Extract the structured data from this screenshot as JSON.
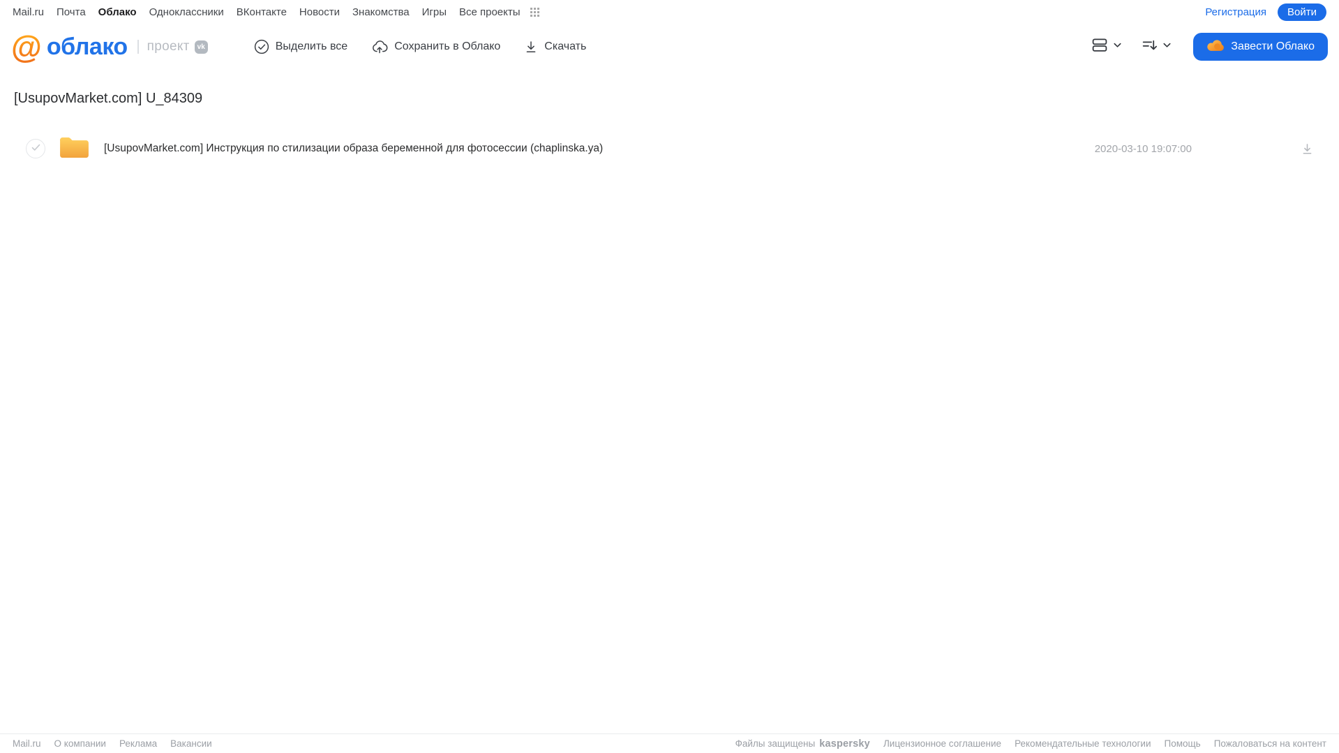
{
  "topnav": {
    "links": [
      "Mail.ru",
      "Почта",
      "Облако",
      "Одноклассники",
      "ВКонтакте",
      "Новости",
      "Знакомства",
      "Игры",
      "Все проекты"
    ],
    "active_link": "Облако",
    "registration_label": "Регистрация",
    "login_label": "Войти"
  },
  "header": {
    "logo": {
      "at_symbol": "@",
      "text": "облако",
      "project_label": "проект",
      "vk_badge": "vk"
    },
    "toolbar": {
      "select_all": "Выделить все",
      "save_to_cloud": "Сохранить в Облако",
      "download": "Скачать"
    },
    "view_controls": {
      "view_icon": "list-view-icon",
      "sort_icon": "sort-icon"
    },
    "cta_label": "Завести Облако"
  },
  "main": {
    "title": "[UsupovMarket.com] U_84309",
    "files": [
      {
        "type": "folder",
        "name": "[UsupovMarket.com] Инструкция по стилизации образа беременной для фотосессии (chaplinska.ya)",
        "date": "2020-03-10 19:07:00"
      }
    ]
  },
  "footer": {
    "left_links": [
      "Mail.ru",
      "О компании",
      "Реклама",
      "Вакансии"
    ],
    "protected_text": "Файлы защищены",
    "kaspersky_brand": "kaspersky",
    "right_links": [
      "Лицензионное соглашение",
      "Рекомендательные технологии",
      "Помощь",
      "Пожаловаться на контент"
    ]
  },
  "colors": {
    "accent_blue": "#1b6ce8",
    "logo_blue": "#2173e8",
    "logo_orange": "#f2851b",
    "folder_yellow": "#f9b344",
    "kaspersky_green": "#26a17b",
    "gray_text": "#9b9fa5"
  }
}
